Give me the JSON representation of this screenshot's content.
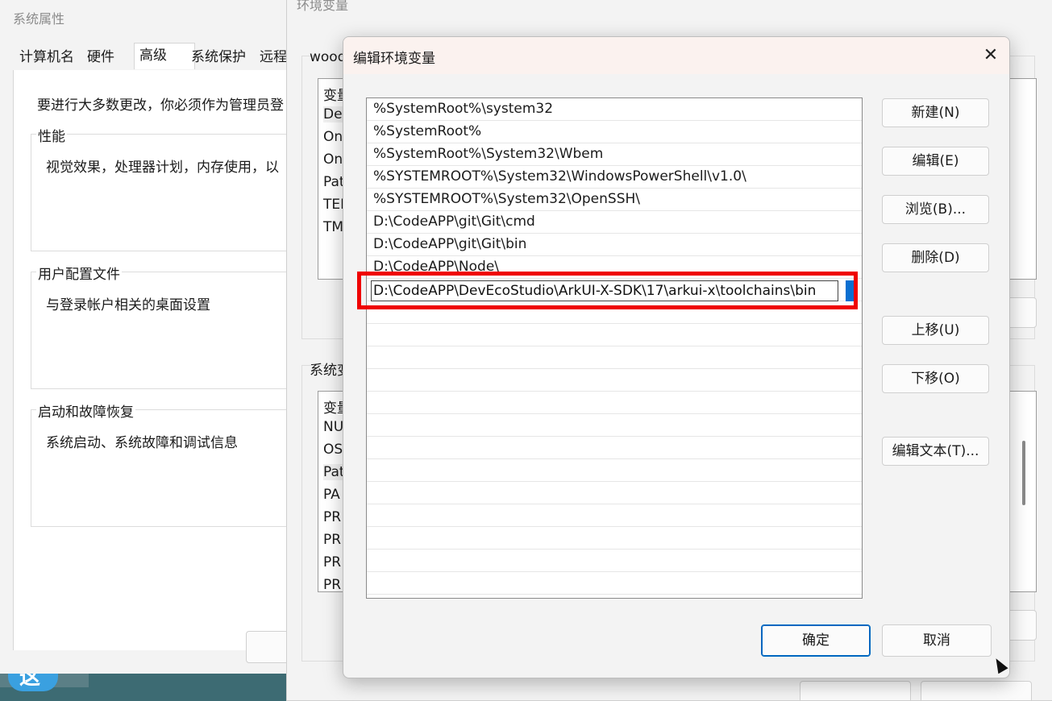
{
  "system_properties": {
    "title": "系统属性",
    "tabs": [
      "计算机名",
      "硬件",
      "高级",
      "系统保护",
      "远程"
    ],
    "active_tab": "高级",
    "notice": "要进行大多数更改，你必须作为管理员登",
    "groups": [
      {
        "title": "性能",
        "desc": "视觉效果，处理器计划，内存使用，以"
      },
      {
        "title": "用户配置文件",
        "desc": "与登录帐户相关的桌面设置"
      },
      {
        "title": "启动和故障恢复",
        "desc": "系统启动、系统故障和调试信息"
      }
    ]
  },
  "env_vars": {
    "title": "环境变量",
    "user_label": "wood",
    "system_label": "系统变",
    "user_list": {
      "header": "变量",
      "rows": [
        "De",
        "On",
        "On",
        "Pat",
        "TEI",
        "TM"
      ]
    },
    "system_list": {
      "header": "变量",
      "rows": [
        "NU",
        "OS",
        "Pat",
        "PA",
        "PR",
        "PR",
        "PR",
        "PR"
      ]
    }
  },
  "dialog": {
    "title": "编辑环境变量",
    "close_glyph": "✕",
    "paths": [
      "%SystemRoot%\\system32",
      "%SystemRoot%",
      "%SystemRoot%\\System32\\Wbem",
      "%SYSTEMROOT%\\System32\\WindowsPowerShell\\v1.0\\",
      "%SYSTEMROOT%\\System32\\OpenSSH\\",
      "D:\\CodeAPP\\git\\Git\\cmd",
      "D:\\CodeAPP\\git\\Git\\bin",
      "D:\\CodeAPP\\Node\\"
    ],
    "editing_value": "D:\\CodeAPP\\DevEcoStudio\\ArkUI-X-SDK\\17\\arkui-x\\toolchains\\bin",
    "buttons": {
      "new": "新建(N)",
      "edit": "编辑(E)",
      "browse": "浏览(B)...",
      "delete": "删除(D)",
      "move_up": "上移(U)",
      "move_down": "下移(O)",
      "edit_text": "编辑文本(T)...",
      "ok": "确定",
      "cancel": "取消"
    },
    "highlight_color": "#ef0000"
  },
  "desktop": {
    "icon_text": "这"
  }
}
